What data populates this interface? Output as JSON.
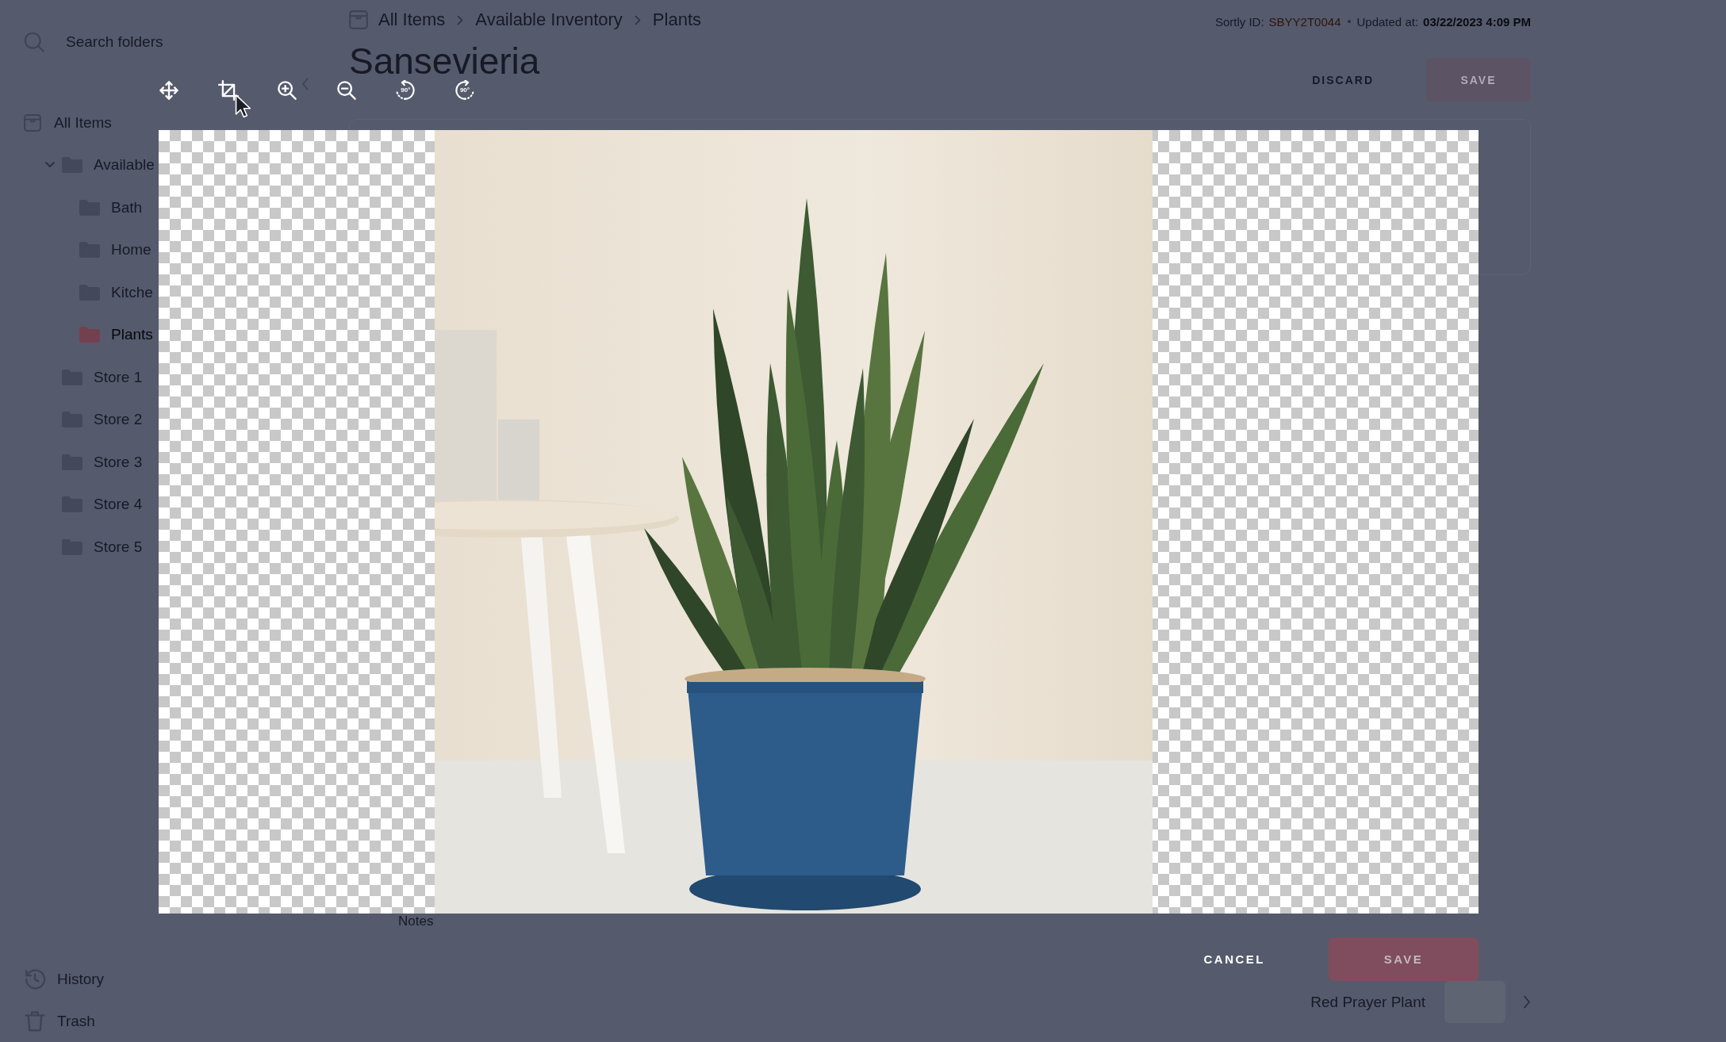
{
  "sidebar": {
    "search": {
      "placeholder": "Search folders"
    },
    "items": [
      {
        "label": "All Items",
        "kind": "root",
        "selected": false,
        "children": [
          {
            "label": "Available",
            "kind": "folder",
            "selected": false,
            "expanded": true,
            "children": [
              {
                "label": "Bath",
                "kind": "folder",
                "selected": false
              },
              {
                "label": "Home",
                "kind": "folder",
                "selected": false
              },
              {
                "label": "Kitche",
                "kind": "folder",
                "selected": false
              },
              {
                "label": "Plants",
                "kind": "folder",
                "selected": true
              }
            ]
          },
          {
            "label": "Store 1",
            "kind": "folder",
            "selected": false
          },
          {
            "label": "Store 2",
            "kind": "folder",
            "selected": false
          },
          {
            "label": "Store 3",
            "kind": "folder",
            "selected": false
          },
          {
            "label": "Store 4",
            "kind": "folder",
            "selected": false
          },
          {
            "label": "Store 5",
            "kind": "folder",
            "selected": false
          }
        ]
      }
    ],
    "footer": [
      {
        "label": "History",
        "kind": "history"
      },
      {
        "label": "Trash",
        "kind": "trash"
      }
    ]
  },
  "header": {
    "breadcrumb": [
      {
        "label": "All Items"
      },
      {
        "label": "Available Inventory"
      },
      {
        "label": "Plants"
      }
    ],
    "meta": [
      {
        "label": "Sortly ID:",
        "value": "SBYY2T0044",
        "kind": "id"
      },
      {
        "label": "Updated at:",
        "value": "03/22/2023 4:09 PM",
        "kind": "date"
      }
    ],
    "title": "Sansevieria",
    "actions": [
      {
        "label": "DISCARD",
        "kind": "discard"
      },
      {
        "label": "SAVE",
        "kind": "save",
        "disabled": true
      }
    ]
  },
  "notes": {
    "label": "Notes"
  },
  "next_item": {
    "name": "Red Prayer Plant"
  },
  "modal": {
    "tools": [
      {
        "kind": "move"
      },
      {
        "kind": "crop"
      },
      {
        "kind": "zoom_in"
      },
      {
        "kind": "zoom_out"
      },
      {
        "kind": "rotate_left",
        "label": "90°"
      },
      {
        "kind": "rotate_right",
        "label": "90°"
      }
    ],
    "actions": [
      {
        "label": "CANCEL",
        "kind": "cancel"
      },
      {
        "label": "SAVE",
        "kind": "save",
        "disabled": true
      }
    ]
  }
}
